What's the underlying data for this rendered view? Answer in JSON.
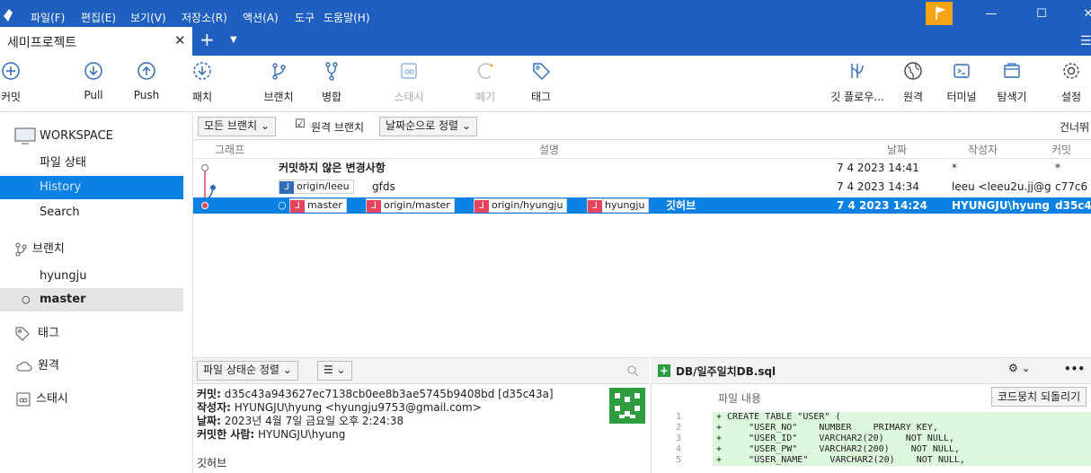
{
  "menu": {
    "items": [
      "파일(F)",
      "편집(E)",
      "보기(V)",
      "저장소(R)",
      "액션(A)",
      "도구",
      "도움말(H)"
    ],
    "window_buttons": [
      "—",
      "☐",
      "✕"
    ]
  },
  "tabs": {
    "active_title": "세미프로젝트",
    "close": "✕",
    "add": "+",
    "more": "▼",
    "side": "☰"
  },
  "toolbar": {
    "commit": "커밋",
    "pull": "Pull",
    "push": "Push",
    "fetch": "패치",
    "branch": "브랜치",
    "merge": "병합",
    "stash": "스태시",
    "discard": "폐기",
    "tag": "태그",
    "git_flow": "깃 플로우...",
    "remote": "원격",
    "terminal": "터미널",
    "explorer": "탐색기",
    "settings": "설정"
  },
  "sidebar": {
    "workspace": "WORKSPACE",
    "file_status": "파일 상태",
    "history": "History",
    "search": "Search",
    "branches": "브랜치",
    "branch_items": [
      "hyungju",
      "master"
    ],
    "tags": "태그",
    "remotes": "원격",
    "stashes": "스태시"
  },
  "filter": {
    "all_branches": "모든 브랜치 ⌄",
    "remote_branches": "원격 브랜치",
    "remote_checked": "☑",
    "sort": "날짜순으로 정렬 ⌄",
    "skip": "건너뛰"
  },
  "columns": {
    "graph": "그래프",
    "description": "설명",
    "date": "날짜",
    "author": "작성자",
    "commit": "커밋"
  },
  "commits": [
    {
      "description": "커밋하지 않은 변경사항",
      "date": "7 4 2023 14:41",
      "author": "*",
      "hash": "*"
    },
    {
      "description": "gfds",
      "date": "7 4 2023 14:34",
      "author": "leeu <leeu2u.jj@g",
      "hash": "c77c6",
      "refs": [
        "origin/leeu"
      ]
    },
    {
      "description": "깃허브",
      "date": "7 4 2023 14:24",
      "author": "HYUNGJU\\hyung",
      "hash": "d35c4",
      "refs": [
        "master",
        "origin/master",
        "origin/hyungju",
        "hyungju"
      ]
    }
  ],
  "detail": {
    "sort": "파일 상태순 정렬 ⌄",
    "view": "☰ ⌄",
    "commit_label": "커밋:",
    "commit_value": "d35c43a943627ec7138cb0ee8b3ae5745b9408bd [d35c43a]",
    "author_label": "작성자:",
    "author_value": "HYUNGJU\\hyung <hyungju9753@gmail.com>",
    "date_label": "날짜:",
    "date_value": "2023년 4월 7일 금요일 오후 2:24:38",
    "committer_label": "커밋한 사람:",
    "committer_value": "HYUNGJU\\hyung",
    "message": "깃허브"
  },
  "diff": {
    "file": "DB/일주일치DB.sql",
    "content_label": "파일 내용",
    "revert_button": "코드뭉치 되돌리기",
    "more": "•••",
    "gear": "⚙ ⌄",
    "lines": [
      {
        "n": "1",
        "text": "+ CREATE TABLE \"USER\" ("
      },
      {
        "n": "2",
        "text": "+     \"USER_NO\"    NUMBER    PRIMARY KEY,"
      },
      {
        "n": "3",
        "text": "+     \"USER_ID\"    VARCHAR2(20)    NOT NULL,"
      },
      {
        "n": "4",
        "text": "+     \"USER_PW\"    VARCHAR2(200)    NOT NULL,"
      },
      {
        "n": "5",
        "text": "+     \"USER_NAME\"    VARCHAR2(20)    NOT NULL,"
      }
    ]
  },
  "colors": {
    "accent": "#1f5fbf",
    "selection": "#0b80e5",
    "branch_tag": "#e2455d",
    "remote_tag": "#2f6db8",
    "diff_added": "#dcf7dc"
  }
}
